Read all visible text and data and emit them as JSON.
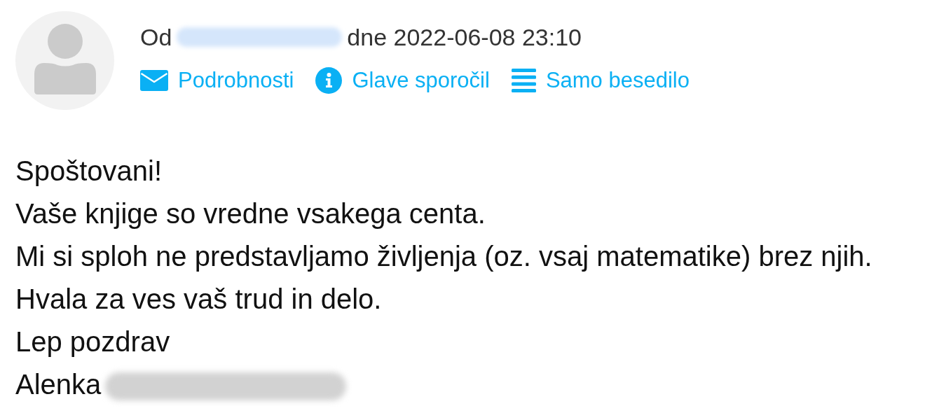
{
  "sender": {
    "label": "Od",
    "name_redacted": true,
    "date_text": "dne 2022-06-08 23:10"
  },
  "actions": [
    {
      "kind": "envelope",
      "label": "Podrobnosti"
    },
    {
      "kind": "info",
      "label": "Glave sporočil"
    },
    {
      "kind": "lines",
      "label": "Samo besedilo"
    }
  ],
  "body": {
    "lines": [
      "Spoštovani!",
      "Vaše knjige so vredne vsakega centa.",
      "Mi si sploh ne predstavljamo življenja (oz. vsaj matematike) brez njih.",
      "Hvala za ves vaš trud in delo.",
      "Lep pozdrav"
    ],
    "signature": {
      "text": "Alenka",
      "surname_redacted": true
    }
  }
}
